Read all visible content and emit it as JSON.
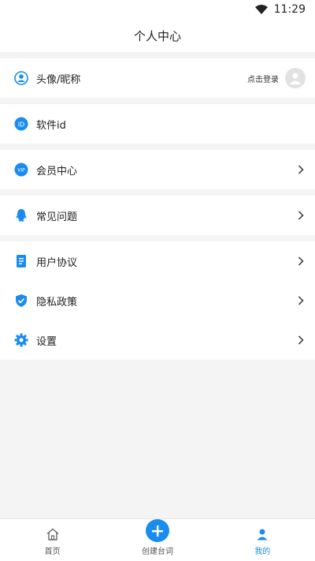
{
  "status": {
    "time": "11:29"
  },
  "header": {
    "title": "个人中心"
  },
  "profile": {
    "label": "头像/昵称",
    "login_text": "点击登录"
  },
  "software": {
    "label": "软件id"
  },
  "vip": {
    "label": "会员中心"
  },
  "faq": {
    "label": "常见问题"
  },
  "links": [
    {
      "label": "用户协议"
    },
    {
      "label": "隐私政策"
    },
    {
      "label": "设置"
    }
  ],
  "tabs": [
    {
      "label": "首页"
    },
    {
      "label": "创建台词"
    },
    {
      "label": "我的"
    }
  ],
  "colors": {
    "accent": "#1a8cf0",
    "background": "#f4f4f4"
  }
}
